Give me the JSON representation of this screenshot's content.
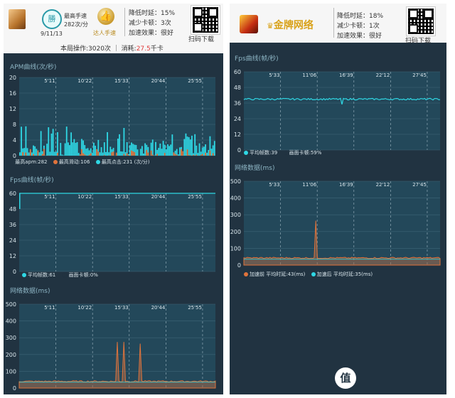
{
  "left": {
    "header": {
      "badge_char": "勝",
      "max_speed_label": "最高手速",
      "max_speed_value": "282次/分",
      "date": "9/11/13",
      "medal_caption": "达人手速",
      "ops_text": "本局操作:3020次 ｜ 消耗:",
      "consume_value": "27.5",
      "consume_unit": "千卡",
      "stats": [
        "降低时延：15%",
        "减少卡顿：3次",
        "加速效果：很好"
      ],
      "qr_caption": "扫码下载"
    },
    "apm": {
      "title": "APM曲线(次/秒)",
      "y_ticks": [
        "20",
        "16",
        "12",
        "8",
        "4",
        "0"
      ],
      "x_ticks": [
        "5'11",
        "10'22",
        "15'33",
        "20'44",
        "25'55"
      ],
      "legend": [
        {
          "label": "最高apm:282",
          "color": "#e0733b"
        },
        {
          "label": "最高滑动:106",
          "color": "#e0733b"
        },
        {
          "label": "最高点击:231 (次/分)",
          "color": "#2fd7e4"
        }
      ]
    },
    "fps": {
      "title": "Fps曲线(帧/秒)",
      "y_ticks": [
        "60",
        "48",
        "36",
        "24",
        "12",
        "0"
      ],
      "x_ticks": [
        "5'11",
        "10'22",
        "15'33",
        "20'44",
        "25'55"
      ],
      "legend": [
        {
          "label": "平均帧数:61",
          "color": "#2fd7e4"
        },
        {
          "label": "画面卡顿:0%",
          "color": "#213341"
        }
      ]
    },
    "net": {
      "title": "网络数据(ms)",
      "y_ticks": [
        "500",
        "400",
        "300",
        "200",
        "100",
        "0"
      ],
      "x_ticks": [
        "5'11",
        "10'22",
        "15'33",
        "20'44",
        "25'55"
      ]
    }
  },
  "right": {
    "header": {
      "brand_name": "金牌网络",
      "stats": [
        "降低时延：18%",
        "减少卡顿：1次",
        "加速效果：很好"
      ],
      "qr_caption": "扫码下载"
    },
    "fps": {
      "title": "Fps曲线(帧/秒)",
      "y_ticks": [
        "60",
        "48",
        "36",
        "24",
        "12",
        "0"
      ],
      "x_ticks": [
        "5'33",
        "11'06",
        "16'39",
        "22'12",
        "27'45"
      ],
      "legend": [
        {
          "label": "平均帧数:39",
          "color": "#2fd7e4"
        },
        {
          "label": "画面卡顿:59%",
          "color": "#213341"
        }
      ]
    },
    "net": {
      "title": "网络数据(ms)",
      "y_ticks": [
        "500",
        "400",
        "300",
        "200",
        "100",
        "0"
      ],
      "x_ticks": [
        "5'33",
        "11'06",
        "16'39",
        "22'12",
        "27'45"
      ],
      "legend": [
        {
          "label": "加速前  平均时延:43(ms)",
          "color": "#e0733b"
        },
        {
          "label": "加速后  平均时延:35(ms)",
          "color": "#2fd7e4"
        }
      ]
    }
  },
  "chart_data": [
    {
      "type": "bar",
      "title": "APM曲线(次/秒)",
      "ylim": [
        0,
        20
      ],
      "x_ticks": [
        "5'11",
        "10'22",
        "15'33",
        "20'44",
        "25'55"
      ],
      "series": [
        {
          "name": "滑动",
          "color": "#e0733b"
        },
        {
          "name": "点击",
          "color": "#2fd7e4"
        }
      ]
    },
    {
      "type": "line",
      "title": "Fps曲线(帧/秒)",
      "ylim": [
        0,
        60
      ],
      "x_ticks": [
        "5'11",
        "10'22",
        "15'33",
        "20'44",
        "25'55"
      ],
      "series": [
        {
          "name": "平均帧数:61",
          "color": "#2fd7e4",
          "level": 61
        }
      ]
    },
    {
      "type": "area",
      "title": "网络数据(ms)",
      "ylim": [
        0,
        500
      ],
      "x_ticks": [
        "5'11",
        "10'22",
        "15'33",
        "20'44",
        "25'55"
      ],
      "series": [
        {
          "name": "加速前",
          "color": "#e0733b",
          "baseline": 40,
          "spikes": [
            275,
            275,
            265
          ]
        },
        {
          "name": "加速后",
          "color": "#2fd7e4",
          "baseline": 35
        }
      ]
    },
    {
      "type": "line",
      "title": "Fps曲线(帧/秒)",
      "ylim": [
        0,
        60
      ],
      "x_ticks": [
        "5'33",
        "11'06",
        "16'39",
        "22'12",
        "27'45"
      ],
      "series": [
        {
          "name": "平均帧数:39",
          "color": "#2fd7e4",
          "level": 39
        }
      ]
    },
    {
      "type": "area",
      "title": "网络数据(ms)",
      "ylim": [
        0,
        500
      ],
      "x_ticks": [
        "5'33",
        "11'06",
        "16'39",
        "22'12",
        "27'45"
      ],
      "series": [
        {
          "name": "加速前  平均时延:43(ms)",
          "color": "#e0733b",
          "baseline": 43,
          "spikes": [
            265
          ]
        },
        {
          "name": "加速后  平均时延:35(ms)",
          "color": "#2fd7e4",
          "baseline": 35
        }
      ]
    }
  ]
}
